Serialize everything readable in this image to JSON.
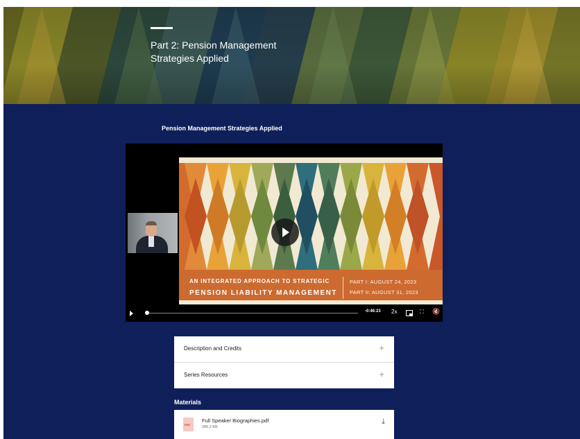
{
  "hero": {
    "title": "Part 2: Pension Management Strategies Applied"
  },
  "video": {
    "heading": "Pension Management Strategies Applied",
    "slide": {
      "line1": "AN INTEGRATED APPROACH TO STRATEGIC",
      "line2": "PENSION LIABILITY MANAGEMENT",
      "part1": "PART I: AUGUST 24, 2023",
      "part2": "PART II: AUGUST 31, 2023"
    },
    "controls": {
      "time": "-0:46:23",
      "speed": "2x",
      "progress": 0
    }
  },
  "accordion": [
    {
      "label": "Description and Credits",
      "icon": "plus-icon"
    },
    {
      "label": "Series Resources",
      "icon": "plus-icon"
    }
  ],
  "materials": {
    "heading": "Materials",
    "files": [
      {
        "name": "Full Speaker Biographies.pdf",
        "size": "285.2 KB",
        "type_badge": "PDF",
        "icon": "download-icon"
      }
    ]
  },
  "colors": {
    "navy": "#0f1f5a",
    "band_orange": "#cc6a30",
    "slide_cream": "#f1e9d2"
  }
}
